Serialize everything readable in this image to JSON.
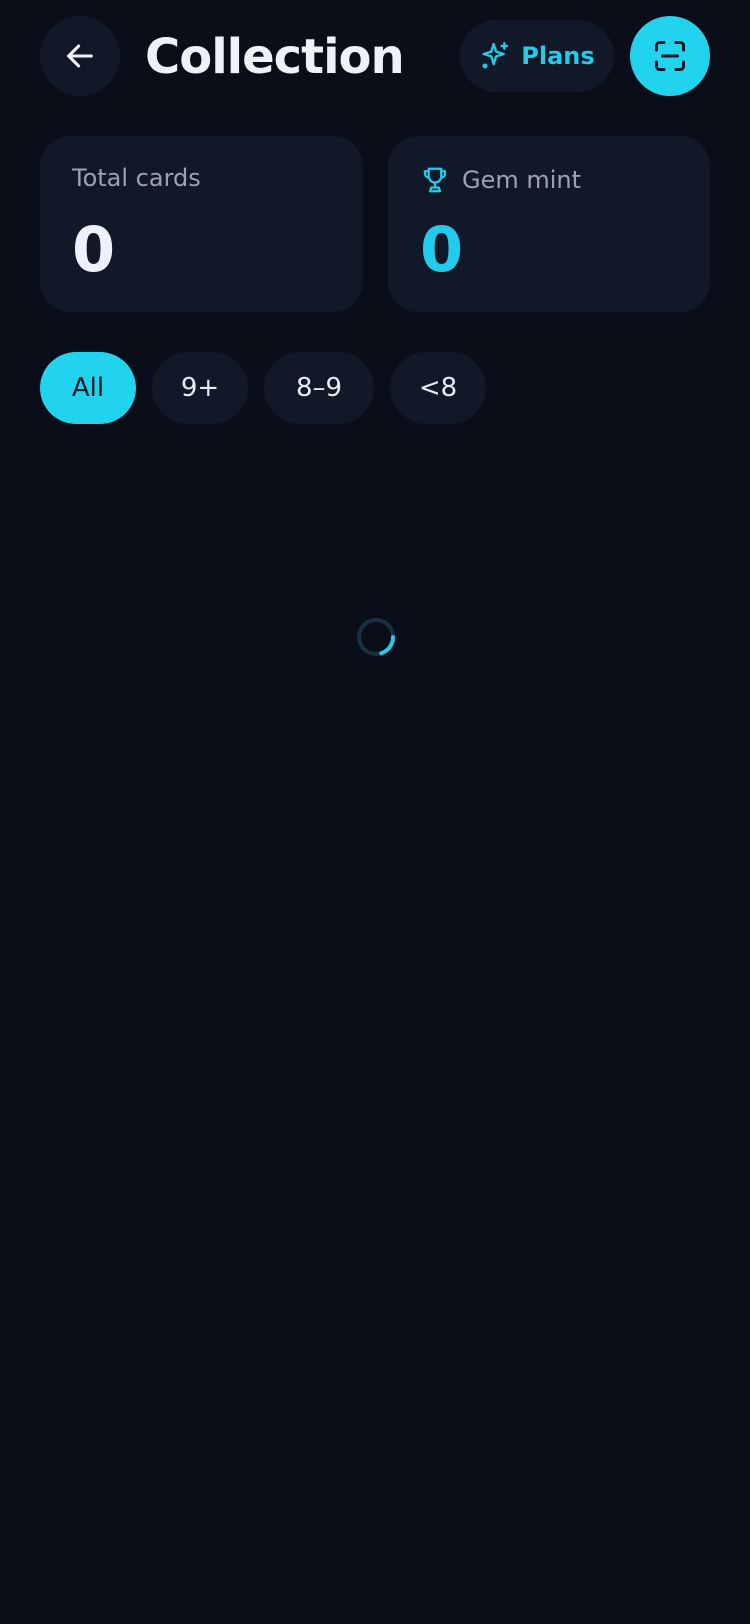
{
  "header": {
    "title": "Collection",
    "back_icon": "arrow-left-icon",
    "plans_label": "Plans",
    "plans_icon": "sparkle-icon",
    "scan_icon": "scan-icon"
  },
  "stats": {
    "total_cards": {
      "label": "Total cards",
      "value": "0"
    },
    "gem_mint": {
      "label": "Gem mint",
      "value": "0",
      "icon": "trophy-icon"
    }
  },
  "filters": {
    "selected": "All",
    "chips": [
      {
        "label": "All"
      },
      {
        "label": "9+"
      },
      {
        "label": "8–9"
      },
      {
        "label": "<8"
      }
    ]
  },
  "loading": {
    "icon": "loading-spinner-icon"
  },
  "colors": {
    "background": "#0a0e18",
    "surface": "#111827",
    "accent": "#22d3ee",
    "text_primary": "#eef1fb",
    "text_secondary": "#9aa3b5"
  }
}
